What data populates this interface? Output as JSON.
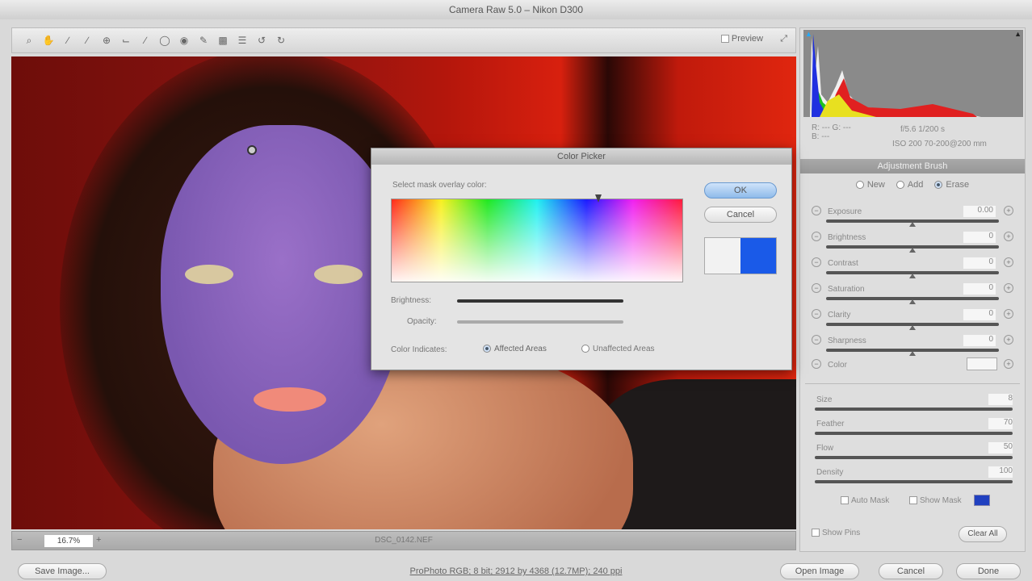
{
  "window": {
    "title": "Camera Raw 5.0 – Nikon D300"
  },
  "toolbar": {
    "tools": [
      "zoom-icon",
      "hand-icon",
      "white-balance-icon",
      "color-sampler-icon",
      "targeted-adjustment-icon",
      "crop-icon",
      "straighten-icon",
      "spot-removal-icon",
      "red-eye-icon",
      "adjustment-brush-icon",
      "graduated-filter-icon",
      "preferences-icon",
      "rotate-left-icon",
      "rotate-right-icon"
    ],
    "preview_label": "Preview"
  },
  "preview": {
    "zoom": "16.7%",
    "filename": "DSC_0142.NEF"
  },
  "histogram": {
    "colors": {
      "red": "#e02020",
      "green": "#20c020",
      "blue": "#2030e0",
      "yellow": "#e8e020"
    }
  },
  "info": {
    "rgb": "R: ---  G: ---  B: ---",
    "line1": "f/5.6   1/200 s",
    "line2": "ISO 200   70-200@200 mm"
  },
  "adjustment_panel": {
    "title": "Adjustment Brush",
    "modes": [
      "New",
      "Add",
      "Erase"
    ],
    "active_mode": "Erase",
    "sliders": [
      {
        "label": "Exposure",
        "value": "0.00",
        "position": 0.5
      },
      {
        "label": "Brightness",
        "value": "0",
        "position": 0.5
      },
      {
        "label": "Contrast",
        "value": "0",
        "position": 0.5
      },
      {
        "label": "Saturation",
        "value": "0",
        "position": 0.5
      },
      {
        "label": "Clarity",
        "value": "0",
        "position": 0.5
      },
      {
        "label": "Sharpness",
        "value": "0",
        "position": 0.5
      }
    ],
    "color_label": "Color",
    "brush": [
      {
        "label": "Size",
        "value": "8"
      },
      {
        "label": "Feather",
        "value": "70"
      },
      {
        "label": "Flow",
        "value": "50"
      },
      {
        "label": "Density",
        "value": "100"
      }
    ],
    "auto_mask": "Auto Mask",
    "show_mask": "Show Mask",
    "mask_color": "#2040c0",
    "show_pins": "Show Pins",
    "clear_all": "Clear All"
  },
  "dialog": {
    "title": "Color Picker",
    "prompt": "Select mask overlay color:",
    "ok": "OK",
    "cancel": "Cancel",
    "brightness_label": "Brightness:",
    "brightness_value": 1.0,
    "opacity_label": "Opacity:",
    "opacity_value": 0.0,
    "old_color": "#f2f2f2",
    "new_color": "#1a5ae8",
    "indicates_label": "Color Indicates:",
    "options": [
      "Affected Areas",
      "Unaffected Areas"
    ],
    "selected_option": "Affected Areas"
  },
  "footer": {
    "save": "Save Image...",
    "workflow": "ProPhoto RGB; 8 bit; 2912 by 4368 (12.7MP); 240 ppi",
    "open": "Open Image",
    "cancel": "Cancel",
    "done": "Done"
  }
}
